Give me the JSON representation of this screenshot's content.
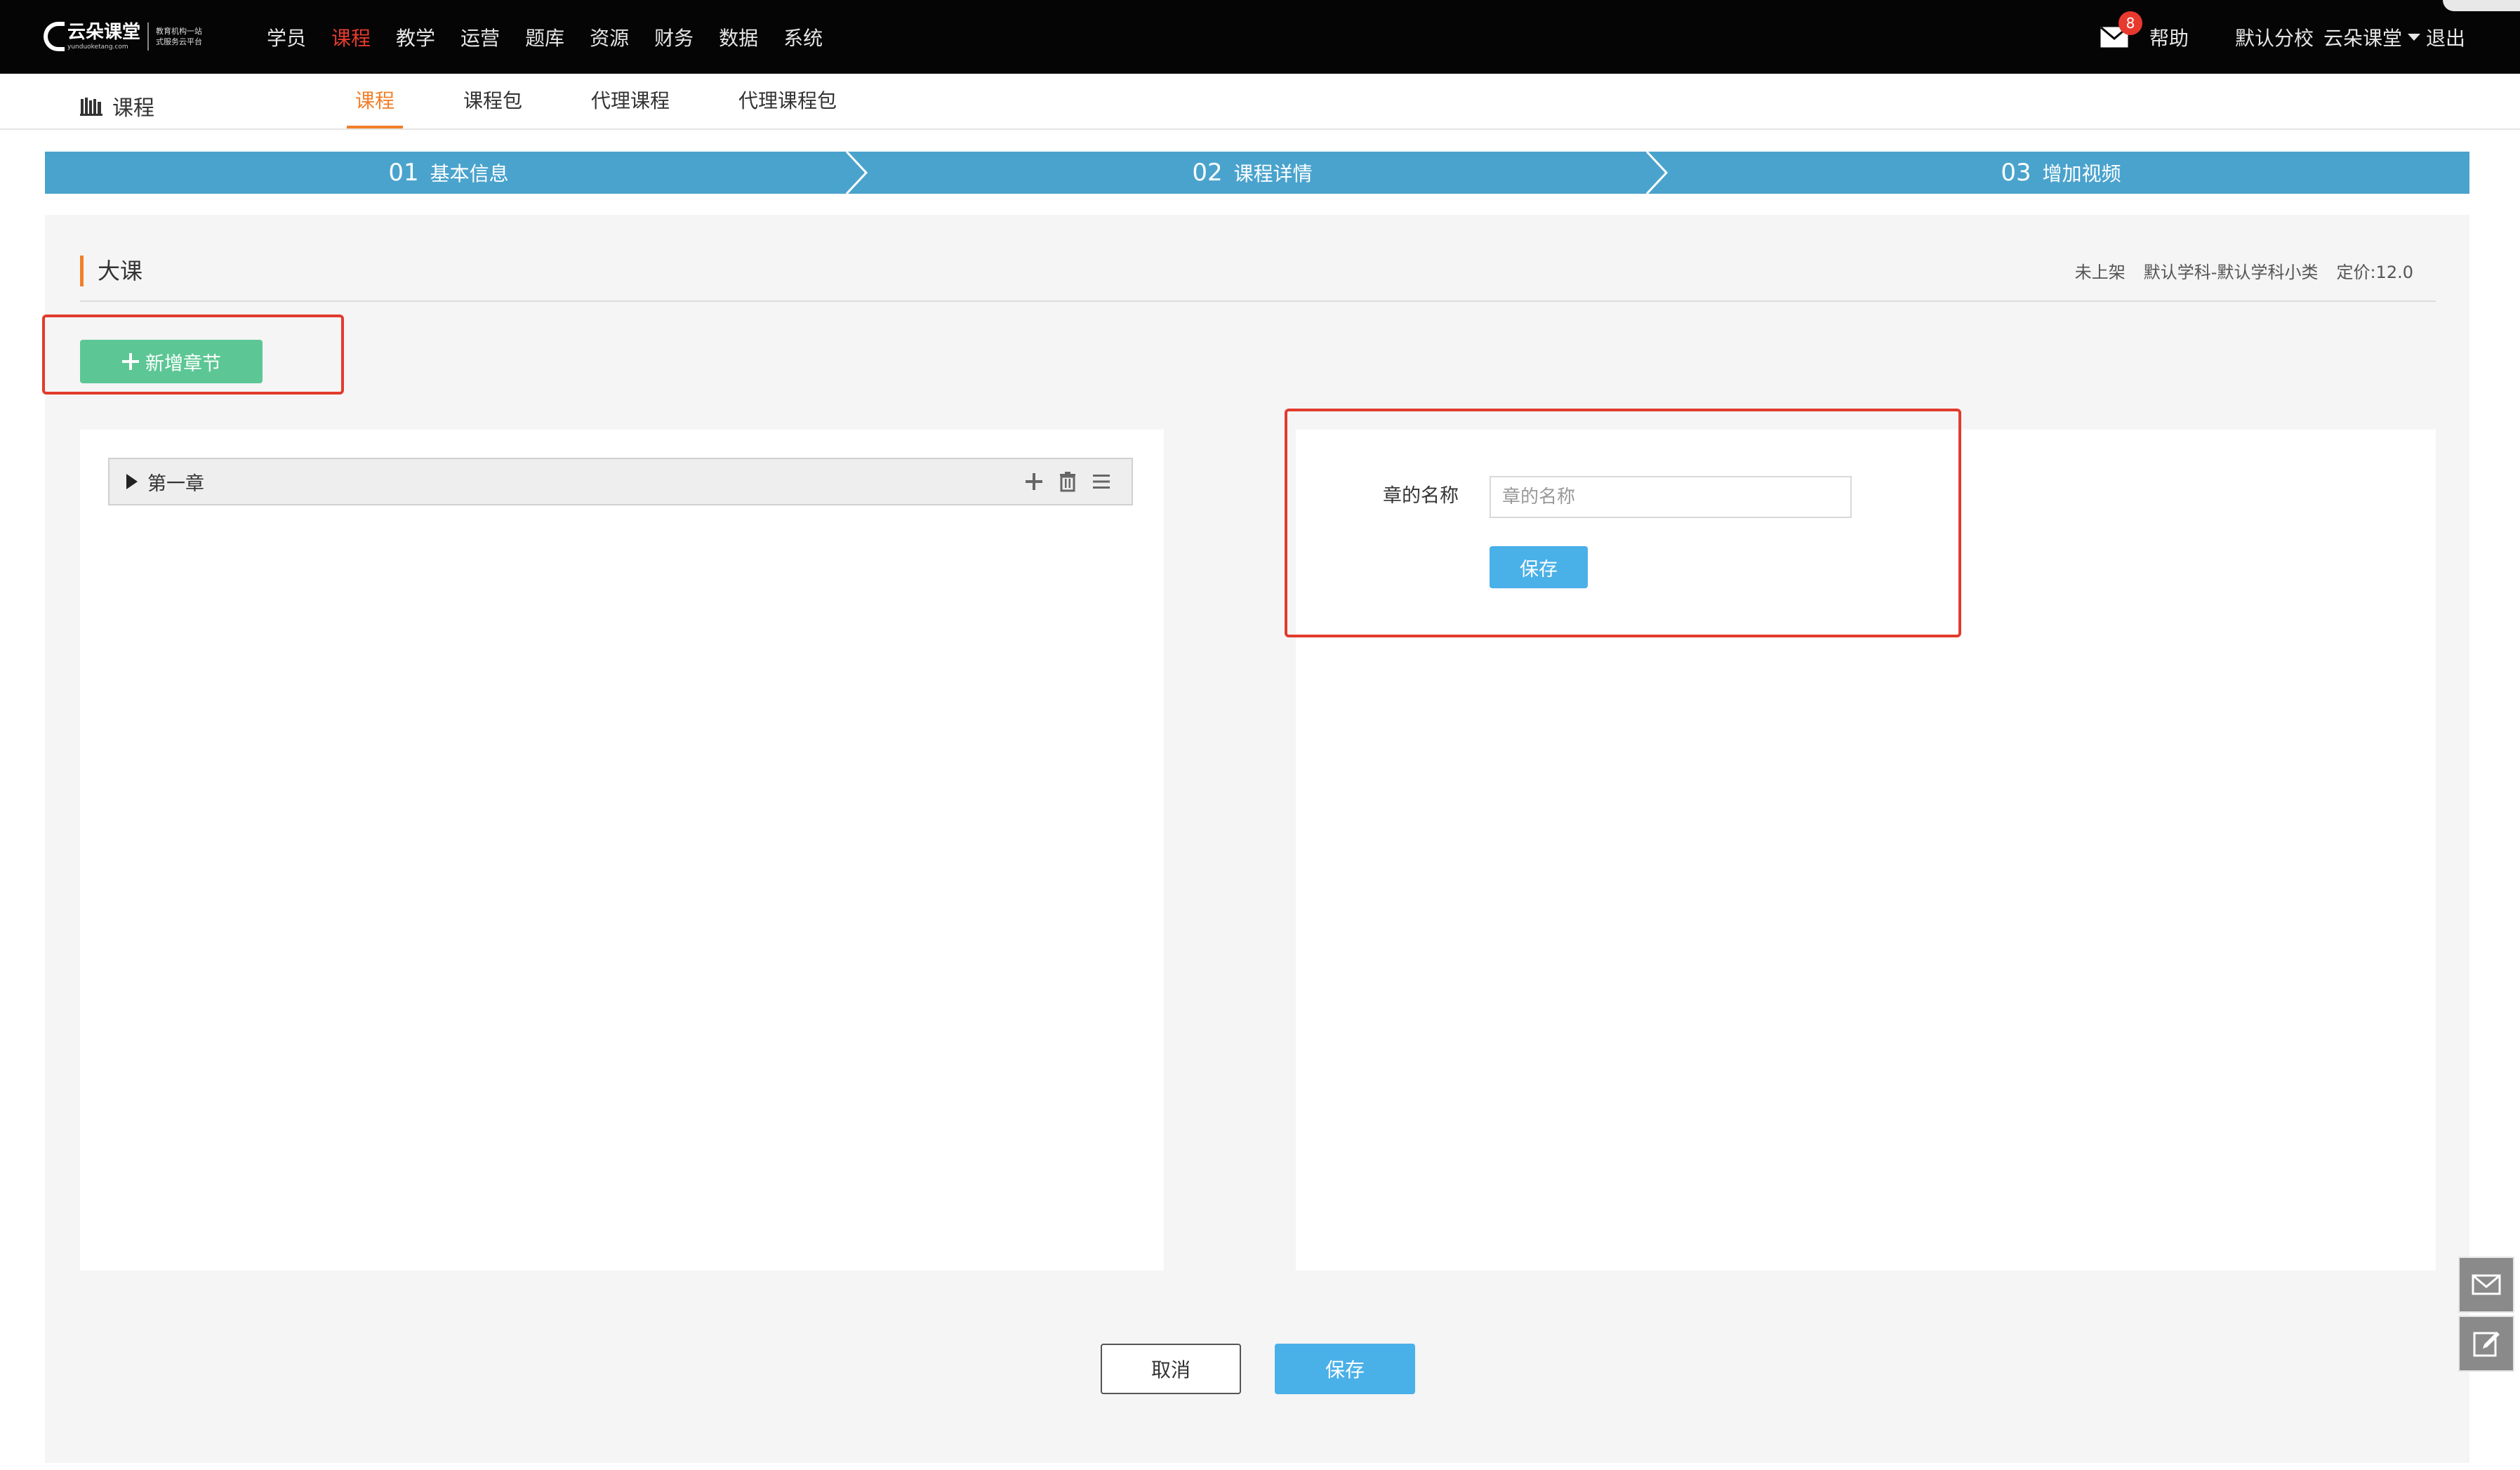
{
  "logo": {
    "name": "云朵课堂",
    "url": "yunduoketang.com",
    "slogan_line1": "教育机构一站",
    "slogan_line2": "式服务云平台"
  },
  "nav": {
    "items": [
      {
        "label": "学员",
        "active": false
      },
      {
        "label": "课程",
        "active": true
      },
      {
        "label": "教学",
        "active": false
      },
      {
        "label": "运营",
        "active": false
      },
      {
        "label": "题库",
        "active": false
      },
      {
        "label": "资源",
        "active": false
      },
      {
        "label": "财务",
        "active": false
      },
      {
        "label": "数据",
        "active": false
      },
      {
        "label": "系统",
        "active": false
      }
    ],
    "active_color": "#e63a2e"
  },
  "topbar": {
    "mail_badge": "8",
    "help": "帮助",
    "branch": "默认分校",
    "user": "云朵课堂",
    "logout": "退出"
  },
  "subnav": {
    "title": "课程",
    "tabs": [
      {
        "label": "课程",
        "active": true
      },
      {
        "label": "课程包",
        "active": false
      },
      {
        "label": "代理课程",
        "active": false
      },
      {
        "label": "代理课程包",
        "active": false
      }
    ],
    "accent": "#f0802c"
  },
  "steps": [
    {
      "num": "01",
      "label": "基本信息"
    },
    {
      "num": "02",
      "label": "课程详情"
    },
    {
      "num": "03",
      "label": "增加视频"
    }
  ],
  "course": {
    "title": "大课",
    "status": "未上架",
    "category": "默认学科-默认学科小类",
    "price": "定价:12.0"
  },
  "add_chapter_label": "新增章节",
  "chapters": [
    {
      "name": "第一章"
    }
  ],
  "chapter_form": {
    "label": "章的名称",
    "placeholder": "章的名称",
    "save_label": "保存"
  },
  "footer_buttons": {
    "cancel": "取消",
    "save": "保存"
  },
  "colors": {
    "topbar_bg": "#050505",
    "steps_bg": "#4aa3cd",
    "add_button": "#5cc794",
    "primary_button": "#4ab0e8",
    "highlight_box": "#e23b2d"
  },
  "icons": {
    "mail": "mail-icon",
    "book": "book-icon",
    "plus": "plus-icon",
    "trash": "trash-icon",
    "menu": "menu-icon",
    "edit": "edit-icon"
  }
}
